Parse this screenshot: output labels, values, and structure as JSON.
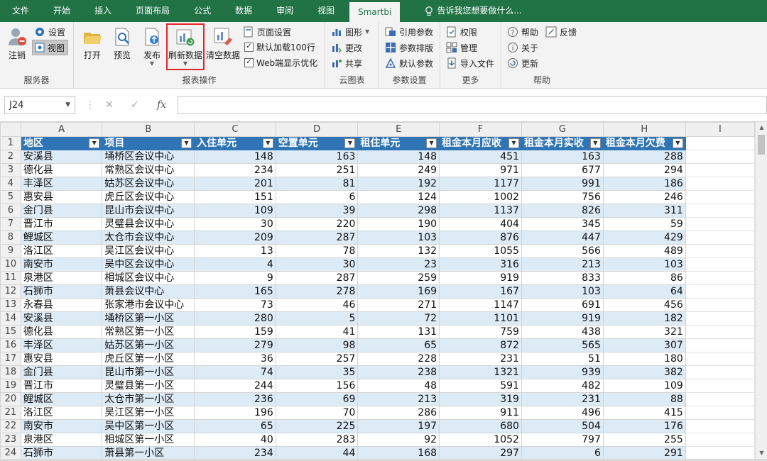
{
  "tabs": [
    "文件",
    "开始",
    "插入",
    "页面布局",
    "公式",
    "数据",
    "审阅",
    "视图",
    "Smartbi"
  ],
  "tell_me": "告诉我您想要做什么...",
  "ribbon": {
    "server": {
      "logout": "注销",
      "settings": "设置",
      "view": "视图",
      "label": "服务器"
    },
    "report": {
      "open": "打开",
      "preview": "预览",
      "publish": "发布",
      "refresh": "刷新数据",
      "clear": "清空数据",
      "page_setup": "页面设置",
      "default_load": "默认加载100行",
      "web_optimize": "Web端显示优化",
      "label": "报表操作"
    },
    "cloud": {
      "chart": "图形",
      "update": "更改",
      "share": "共享",
      "label": "云图表"
    },
    "params": {
      "ref": "引用参数",
      "layout": "参数排版",
      "default": "默认参数",
      "label": "参数设置"
    },
    "more": {
      "perm": "权限",
      "manage": "管理",
      "import": "导入文件",
      "label": "更多"
    },
    "help": {
      "help": "帮助",
      "feedback": "反馈",
      "about": "关于",
      "update": "更新",
      "label": "帮助"
    }
  },
  "name_box": "J24",
  "columns": [
    "A",
    "B",
    "C",
    "D",
    "E",
    "F",
    "G",
    "H",
    "I"
  ],
  "headers": [
    "地区",
    "项目",
    "入住单元",
    "空置单元",
    "租住单元",
    "租金本月应收",
    "租金本月实收",
    "租金本月欠费"
  ],
  "rows": [
    [
      "安溪县",
      "埇桥区会议中心",
      148,
      163,
      148,
      451,
      163,
      288
    ],
    [
      "德化县",
      "常熟区会议中心",
      234,
      251,
      249,
      971,
      677,
      294
    ],
    [
      "丰泽区",
      "姑苏区会议中心",
      201,
      81,
      192,
      1177,
      991,
      186
    ],
    [
      "惠安县",
      "虎丘区会议中心",
      151,
      6,
      124,
      1002,
      756,
      246
    ],
    [
      "金门县",
      "昆山市会议中心",
      109,
      39,
      298,
      1137,
      826,
      311
    ],
    [
      "晋江市",
      "灵璧县会议中心",
      30,
      220,
      190,
      404,
      345,
      59
    ],
    [
      "鲤城区",
      "太仓市会议中心",
      209,
      287,
      103,
      876,
      447,
      429
    ],
    [
      "洛江区",
      "吴江区会议中心",
      13,
      78,
      132,
      1055,
      566,
      489
    ],
    [
      "南安市",
      "吴中区会议中心",
      4,
      30,
      23,
      316,
      213,
      103
    ],
    [
      "泉港区",
      "相城区会议中心",
      9,
      287,
      259,
      919,
      833,
      86
    ],
    [
      "石狮市",
      "萧县会议中心",
      165,
      278,
      169,
      167,
      103,
      64
    ],
    [
      "永春县",
      "张家港市会议中心",
      73,
      46,
      271,
      1147,
      691,
      456
    ],
    [
      "安溪县",
      "埇桥区第一小区",
      280,
      5,
      72,
      1101,
      919,
      182
    ],
    [
      "德化县",
      "常熟区第一小区",
      159,
      41,
      131,
      759,
      438,
      321
    ],
    [
      "丰泽区",
      "姑苏区第一小区",
      279,
      98,
      65,
      872,
      565,
      307
    ],
    [
      "惠安县",
      "虎丘区第一小区",
      36,
      257,
      228,
      231,
      51,
      180
    ],
    [
      "金门县",
      "昆山市第一小区",
      74,
      35,
      238,
      1321,
      939,
      382
    ],
    [
      "晋江市",
      "灵璧县第一小区",
      244,
      156,
      48,
      591,
      482,
      109
    ],
    [
      "鲤城区",
      "太仓市第一小区",
      236,
      69,
      213,
      319,
      231,
      88
    ],
    [
      "洛江区",
      "吴江区第一小区",
      196,
      70,
      286,
      911,
      496,
      415
    ],
    [
      "南安市",
      "吴中区第一小区",
      65,
      225,
      197,
      680,
      504,
      176
    ],
    [
      "泉港区",
      "相城区第一小区",
      40,
      283,
      92,
      1052,
      797,
      255
    ],
    [
      "石狮市",
      "萧县第一小区",
      234,
      44,
      168,
      297,
      6,
      291
    ]
  ],
  "colors": {
    "brand": "#217346",
    "header": "#2f75b5",
    "band": "#ddebf7",
    "highlight": "#e0262b"
  }
}
